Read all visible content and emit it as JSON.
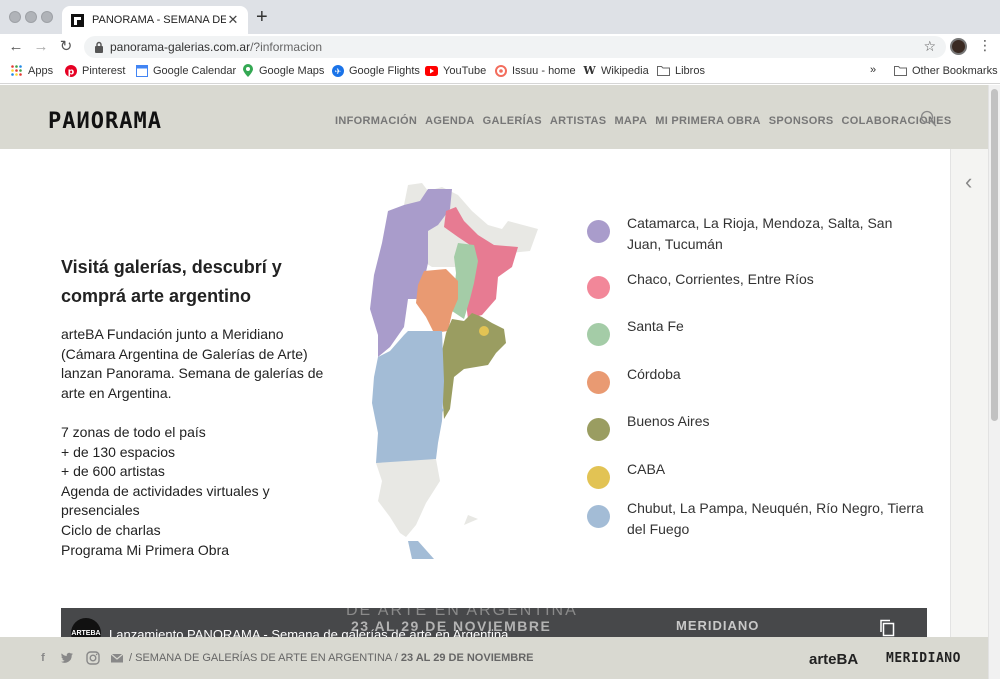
{
  "browser": {
    "tab_title": "PANORAMA - SEMANA DE GALERÍAS",
    "url_host": "panorama-galerias.com.ar",
    "url_path": "/?informacion",
    "bookmarks": [
      "Apps",
      "Pinterest",
      "Google Calendar",
      "Google Maps",
      "Google Flights",
      "YouTube",
      "Issuu - home",
      "Wikipedia",
      "Libros"
    ],
    "more_bookmarks": "»",
    "other_bookmarks": "Other Bookmarks"
  },
  "site": {
    "logo": "PAИORAMA",
    "nav": [
      "INFORMACIÓN",
      "AGENDA",
      "GALERÍAS",
      "ARTISTAS",
      "MAPA",
      "MI PRIMERA OBRA",
      "SPONSORS",
      "COLABORACIONES"
    ]
  },
  "intro": {
    "heading": "Visitá galerías, descubrí y comprá arte argentino",
    "paragraph": "arteBA Fundación junto a Meridiano (Cámara Argentina de Galerías de Arte) lanzan Panorama. Semana de galerías de arte en Argentina.",
    "facts": [
      "7 zonas de todo el país",
      "+ de 130 espacios",
      "+ de 600 artistas",
      "Agenda de actividades virtuales y presenciales",
      "Ciclo de charlas",
      "Programa Mi Primera Obra"
    ]
  },
  "legend": [
    {
      "label": "Catamarca, La Rioja, Mendoza, Salta, San Juan, Tucumán",
      "color": "#a99ccb"
    },
    {
      "label": "Chaco, Corrientes, Entre Ríos",
      "color": "#f28799"
    },
    {
      "label": "Santa Fe",
      "color": "#a4cca7"
    },
    {
      "label": "Córdoba",
      "color": "#e99a72"
    },
    {
      "label": "Buenos Aires",
      "color": "#9a9d61"
    },
    {
      "label": "CABA",
      "color": "#e2c354"
    },
    {
      "label": "Chubut, La Pampa, Neuquén, Río Negro, Tierra del Fuego",
      "color": "#a3bcd6"
    }
  ],
  "map_colors": {
    "other": "#e8e8e4",
    "northwest": "#a99ccb",
    "northeast": "#e77b92",
    "santafe": "#a4cca7",
    "cordoba": "#e99a72",
    "buenosaires": "#9a9d61",
    "caba": "#e2c354",
    "patagonia": "#a3bcd6"
  },
  "video": {
    "channel": "ARTEBA",
    "title": "Lanzamiento PANORAMA - Semana de galerías de arte en Argentina",
    "bg_line1": "DE ARTE EN ARGENTINA",
    "bg_line2": "23 AL 29 DE NOVIEMBRE",
    "bg_brand": "MERIDIANO"
  },
  "footer": {
    "text": "/ SEMANA DE GALERÍAS DE ARTE EN ARGENTINA /",
    "dates": "23 AL 29 DE NOVIEMBRE",
    "partner1": "arteBA",
    "partner2": "MERIDIANO"
  }
}
